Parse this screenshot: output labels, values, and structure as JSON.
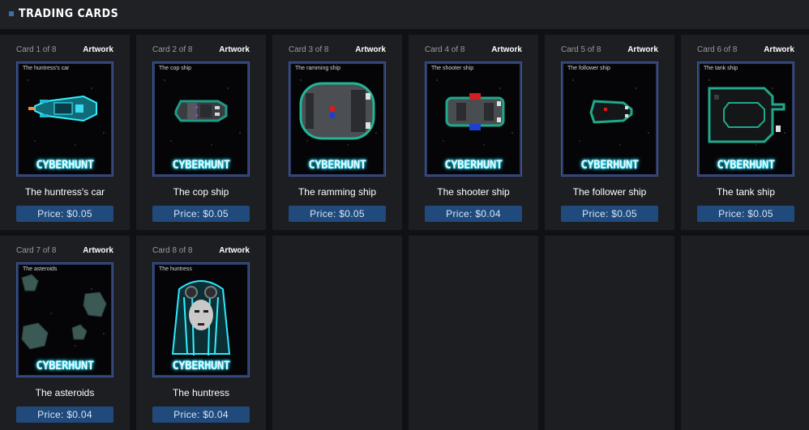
{
  "section": {
    "title": "TRADING CARDS"
  },
  "cards": [
    {
      "number": "Card 1 of 8",
      "tag": "Artwork",
      "art_label": "The huntress's car",
      "name": "The huntress's car",
      "price": "Price: $0.05",
      "logo": "CYBERHUNT",
      "art_icon": "car-icon"
    },
    {
      "number": "Card 2 of 8",
      "tag": "Artwork",
      "art_label": "The cop ship",
      "name": "The cop ship",
      "price": "Price: $0.05",
      "logo": "CYBERHUNT",
      "art_icon": "cop-ship-icon"
    },
    {
      "number": "Card 3 of 8",
      "tag": "Artwork",
      "art_label": "The ramming ship",
      "name": "The ramming ship",
      "price": "Price: $0.05",
      "logo": "CYBERHUNT",
      "art_icon": "ramming-ship-icon"
    },
    {
      "number": "Card 4 of 8",
      "tag": "Artwork",
      "art_label": "The shooter ship",
      "name": "The shooter ship",
      "price": "Price: $0.04",
      "logo": "CYBERHUNT",
      "art_icon": "shooter-ship-icon"
    },
    {
      "number": "Card 5 of 8",
      "tag": "Artwork",
      "art_label": "The follower ship",
      "name": "The follower ship",
      "price": "Price: $0.05",
      "logo": "CYBERHUNT",
      "art_icon": "follower-ship-icon"
    },
    {
      "number": "Card 6 of 8",
      "tag": "Artwork",
      "art_label": "The tank ship",
      "name": "The tank ship",
      "price": "Price: $0.05",
      "logo": "CYBERHUNT",
      "art_icon": "tank-ship-icon"
    },
    {
      "number": "Card 7 of 8",
      "tag": "Artwork",
      "art_label": "The asteroids",
      "name": "The asteroids",
      "price": "Price: $0.04",
      "logo": "CYBERHUNT",
      "art_icon": "asteroids-icon"
    },
    {
      "number": "Card 8 of 8",
      "tag": "Artwork",
      "art_label": "The huntress",
      "name": "The huntress",
      "price": "Price: $0.04",
      "logo": "CYBERHUNT",
      "art_icon": "huntress-portrait-icon"
    }
  ],
  "colors": {
    "accent": "#204a7c",
    "glow": "#2ee8ff",
    "background": "#101114",
    "tile": "#1d1e22"
  }
}
